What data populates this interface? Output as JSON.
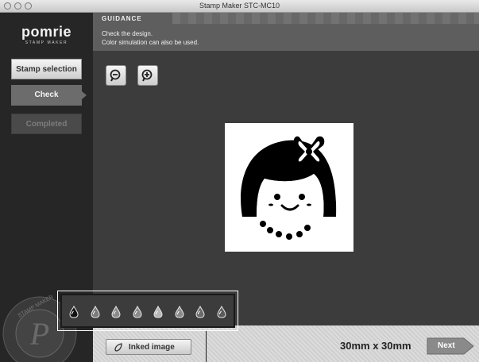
{
  "window": {
    "title": "Stamp Maker STC-MC10"
  },
  "logo": {
    "brand": "pomrie",
    "subtitle": "STAMP MAKER"
  },
  "steps": [
    {
      "label": "Stamp selection",
      "state": "done"
    },
    {
      "label": "Check",
      "state": "current"
    },
    {
      "label": "Completed",
      "state": "disabled"
    }
  ],
  "guidance": {
    "title": "GUIDANCE",
    "line1": "Check the design.",
    "line2": "Color simulation can also be used."
  },
  "toolbar": {
    "zoom_out_icon": "zoom-out-icon",
    "zoom_in_icon": "zoom-in-icon"
  },
  "preview": {
    "design": "girl with bob haircut, bow and bead necklace"
  },
  "ink_palette": {
    "count": 8,
    "colors": [
      "#111111",
      "#7a7a7a",
      "#8a8a8a",
      "#8a8a8a",
      "#b5b5b5",
      "#8a8a8a",
      "#6a6a6a",
      "#5a5a5a"
    ],
    "selected_index": 0
  },
  "bottom": {
    "inked_label": "Inked image",
    "size": "30mm x 30mm",
    "next_label": "Next"
  },
  "seal": {
    "text": "STAMP MAKER pomrie"
  }
}
